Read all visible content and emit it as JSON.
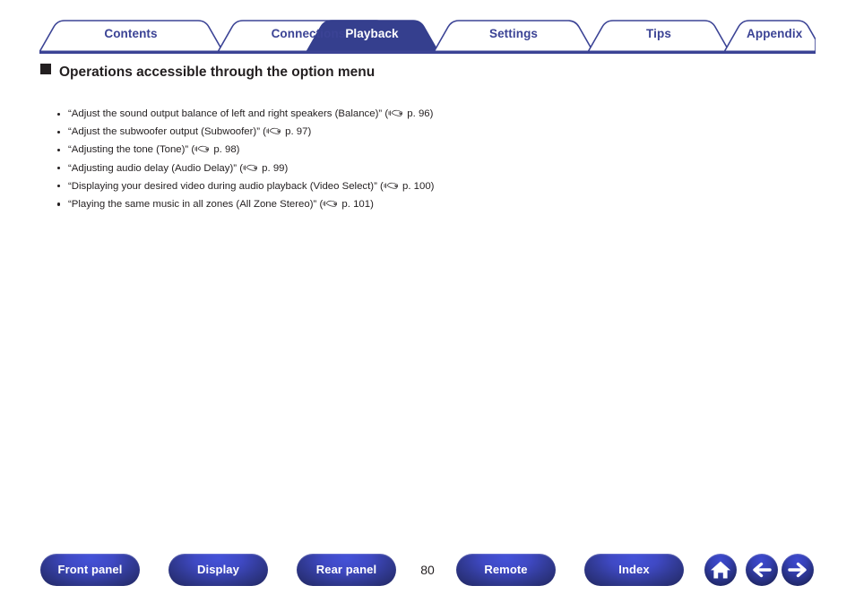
{
  "colors": {
    "tab_blue": "#3b4395",
    "tab_active_fill": "#353f8e",
    "button_blue": "#3f49c4",
    "button_dark": "#272e72",
    "text": "#231f20"
  },
  "tabs": [
    {
      "label": "Contents",
      "active": false
    },
    {
      "label": "Connections",
      "active": false
    },
    {
      "label": "Playback",
      "active": true
    },
    {
      "label": "Settings",
      "active": false
    },
    {
      "label": "Tips",
      "active": false
    },
    {
      "label": "Appendix",
      "active": false
    }
  ],
  "heading": {
    "bullet_icon": "black-square-icon",
    "text": "Operations accessible through the option menu"
  },
  "bullets": [
    {
      "text_before": "“Adjust the sound output balance of left and right speakers (Balance)” (",
      "icon": "pointing-hand-icon",
      "page_ref": " p. 96)"
    },
    {
      "text_before": "“Adjust the subwoofer output (Subwoofer)” (",
      "icon": "pointing-hand-icon",
      "page_ref": " p. 97)"
    },
    {
      "text_before": "“Adjusting the tone (Tone)” (",
      "icon": "pointing-hand-icon",
      "page_ref": " p. 98)"
    },
    {
      "text_before": "“Adjusting audio delay (Audio Delay)” (",
      "icon": "pointing-hand-icon",
      "page_ref": " p. 99)"
    },
    {
      "text_before": "“Displaying your desired video during audio playback (Video Select)” (",
      "icon": "pointing-hand-icon",
      "page_ref": " p. 100)"
    },
    {
      "text_before": "“Playing the same music in all zones (All Zone Stereo)” (",
      "icon": "pointing-hand-icon",
      "page_ref": " p. 101)"
    }
  ],
  "footer": {
    "buttons": [
      {
        "label": "Front panel"
      },
      {
        "label": "Display"
      },
      {
        "label": "Rear panel"
      },
      {
        "label": "Remote"
      },
      {
        "label": "Index"
      }
    ],
    "page_number": "80",
    "icon_buttons": [
      {
        "name": "home-icon"
      },
      {
        "name": "back-arrow-icon"
      },
      {
        "name": "forward-arrow-icon"
      }
    ]
  }
}
